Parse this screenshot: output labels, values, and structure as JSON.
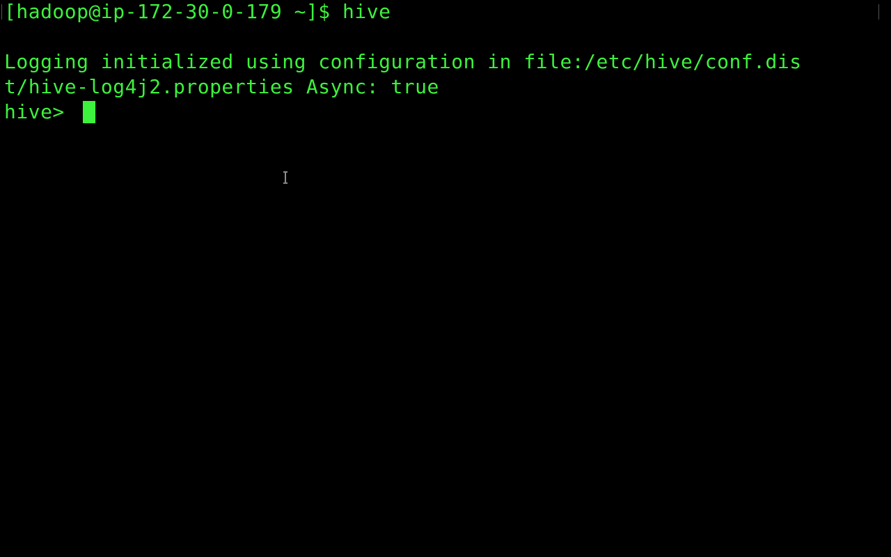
{
  "terminal": {
    "background_color": "#000000",
    "text_color": "#3cf23c",
    "lines": [
      "[hadoop@ip-172-30-0-179 ~]$ hive",
      "",
      "Logging initialized using configuration in file:/etc/hive/conf.dis",
      "t/hive-log4j2.properties Async: true"
    ],
    "prompt": "hive> ",
    "input_value": "",
    "cursor_icon": "block-cursor",
    "mouse_pointer_icon": "text-ibeam-icon"
  }
}
